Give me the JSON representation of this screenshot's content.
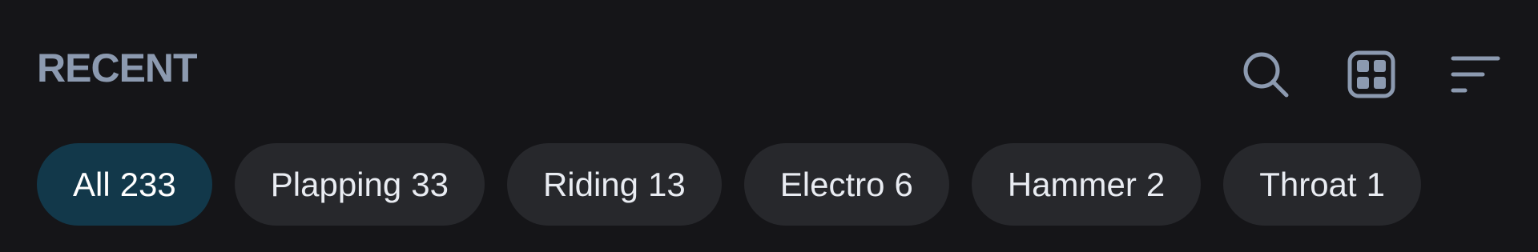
{
  "header": {
    "title": "RECENT"
  },
  "toolbar": {
    "icons": [
      "search-icon",
      "grid-view-icon",
      "sort-icon"
    ],
    "icon_color": "#8c9ab0"
  },
  "filters": [
    {
      "label": "All",
      "count": "233",
      "active": true
    },
    {
      "label": "Plapping",
      "count": "33",
      "active": false
    },
    {
      "label": "Riding",
      "count": "13",
      "active": false
    },
    {
      "label": "Electro",
      "count": "6",
      "active": false
    },
    {
      "label": "Hammer",
      "count": "2",
      "active": false
    },
    {
      "label": "Throat",
      "count": "1",
      "active": false
    }
  ],
  "colors": {
    "background": "#151518",
    "chip": "#27282c",
    "chip_active": "#12384a",
    "chip_text": "#e9ecf2",
    "title": "#8c9ab0"
  }
}
